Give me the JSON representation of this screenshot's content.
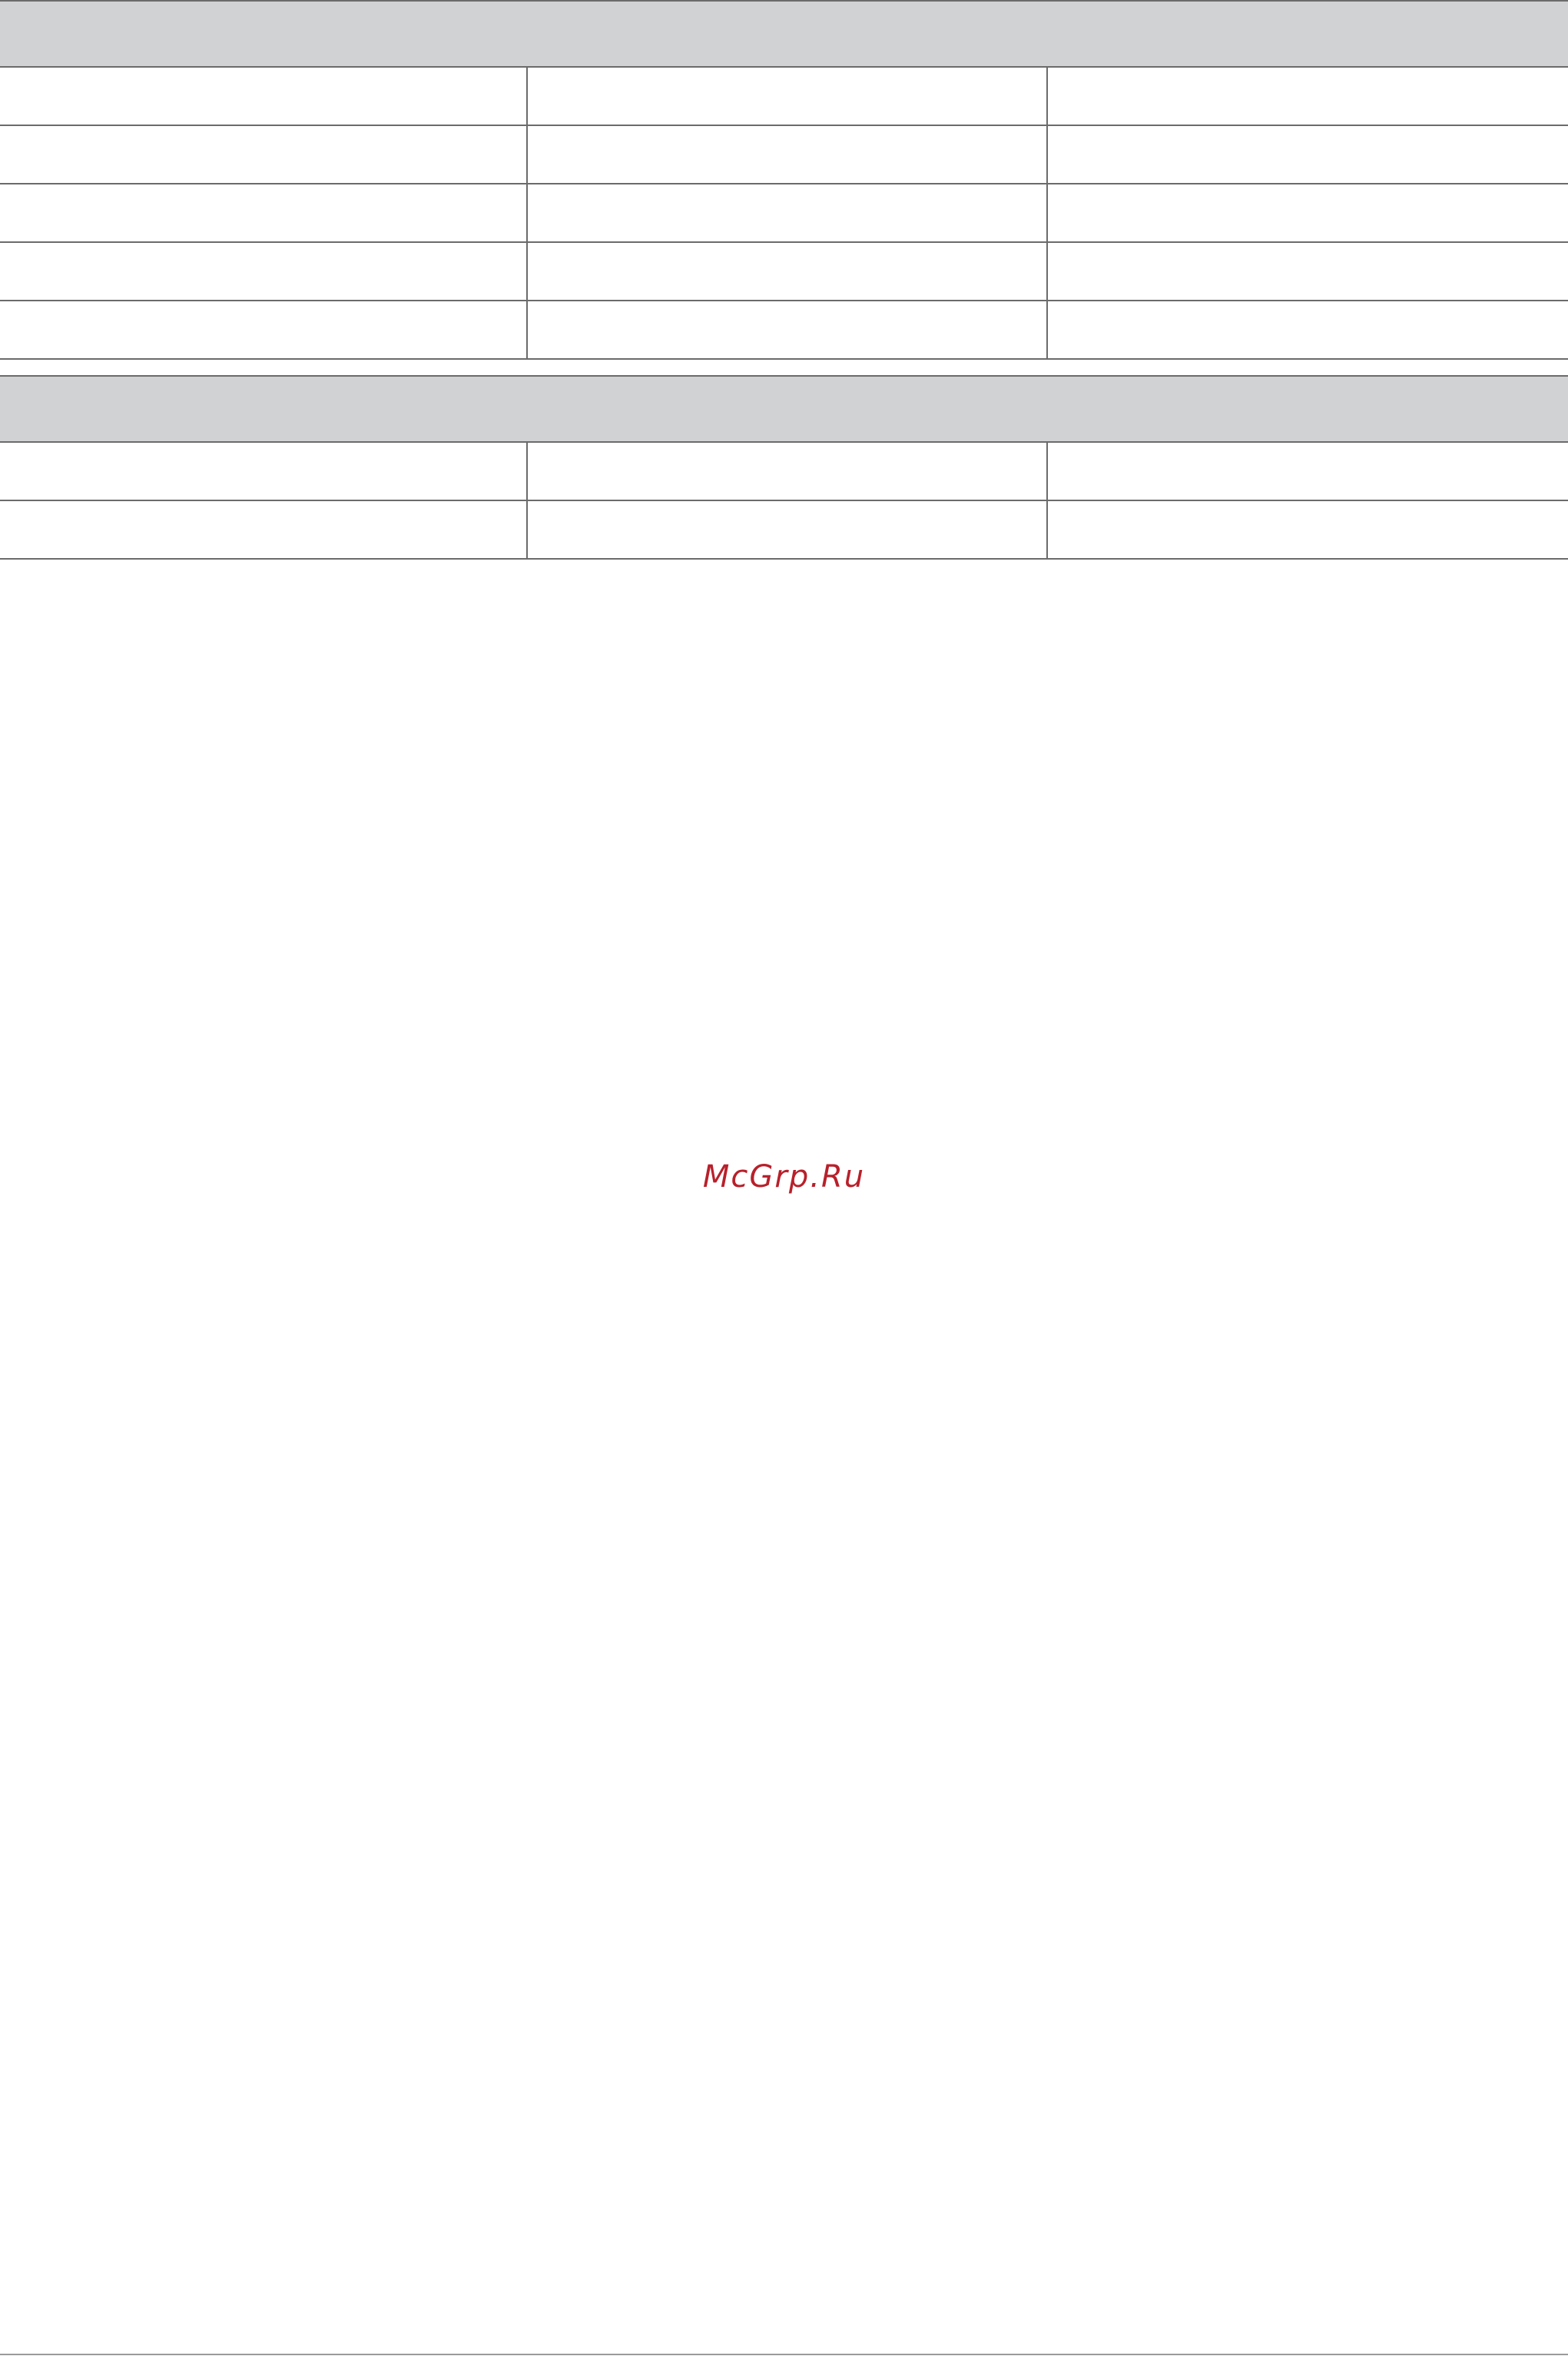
{
  "tables": [
    {
      "header": "",
      "rows": [
        [
          "",
          "",
          ""
        ],
        [
          "",
          "",
          ""
        ],
        [
          "",
          "",
          ""
        ],
        [
          "",
          "",
          ""
        ],
        [
          "",
          "",
          ""
        ]
      ]
    },
    {
      "header": "",
      "rows": [
        [
          "",
          "",
          ""
        ],
        [
          "",
          "",
          ""
        ]
      ]
    }
  ],
  "watermark": "McGrp.Ru",
  "colors": {
    "header_fill": "#d1d2d4",
    "rule": "#6b6b6b",
    "watermark": "#b8202b"
  }
}
